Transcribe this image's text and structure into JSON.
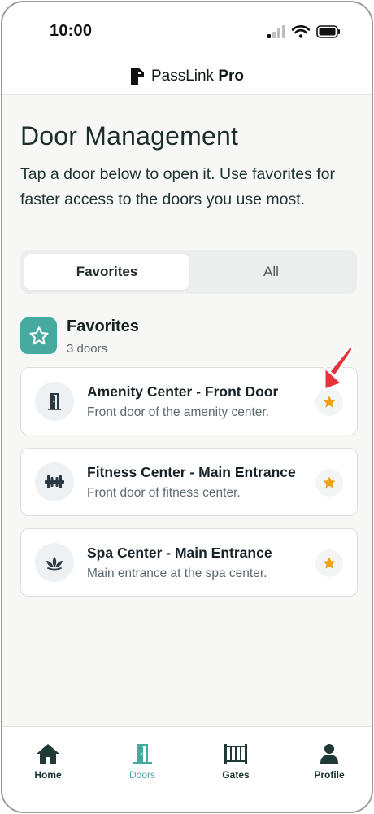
{
  "status_bar": {
    "time": "10:00"
  },
  "brand": {
    "name": "PassLink",
    "suffix": "Pro"
  },
  "page": {
    "title": "Door Management",
    "subtitle": "Tap a door below to open it. Use favorites for faster access to the doors you use most."
  },
  "segmented": {
    "favorites_label": "Favorites",
    "all_label": "All",
    "selected": "Favorites"
  },
  "section": {
    "title": "Favorites",
    "count": "3 doors",
    "icon": "star-icon"
  },
  "doors": [
    {
      "title": "Amenity Center - Front Door",
      "description": "Front door of the amenity center.",
      "icon": "door-icon",
      "favorite": true
    },
    {
      "title": "Fitness Center - Main Entrance",
      "description": "Front door of fitness center.",
      "icon": "dumbbell-icon",
      "favorite": true
    },
    {
      "title": "Spa Center - Main Entrance",
      "description": "Main entrance at the spa center.",
      "icon": "lotus-icon",
      "favorite": true
    }
  ],
  "nav": {
    "items": [
      {
        "label": "Home",
        "icon": "home-icon"
      },
      {
        "label": "Doors",
        "icon": "door-icon"
      },
      {
        "label": "Gates",
        "icon": "gate-icon"
      },
      {
        "label": "Profile",
        "icon": "person-icon"
      }
    ],
    "active": "Doors"
  },
  "colors": {
    "accent": "#47aaa1",
    "star": "#f2a01c",
    "pointer": "#e8323a",
    "text_dark": "#1b2e2c"
  }
}
